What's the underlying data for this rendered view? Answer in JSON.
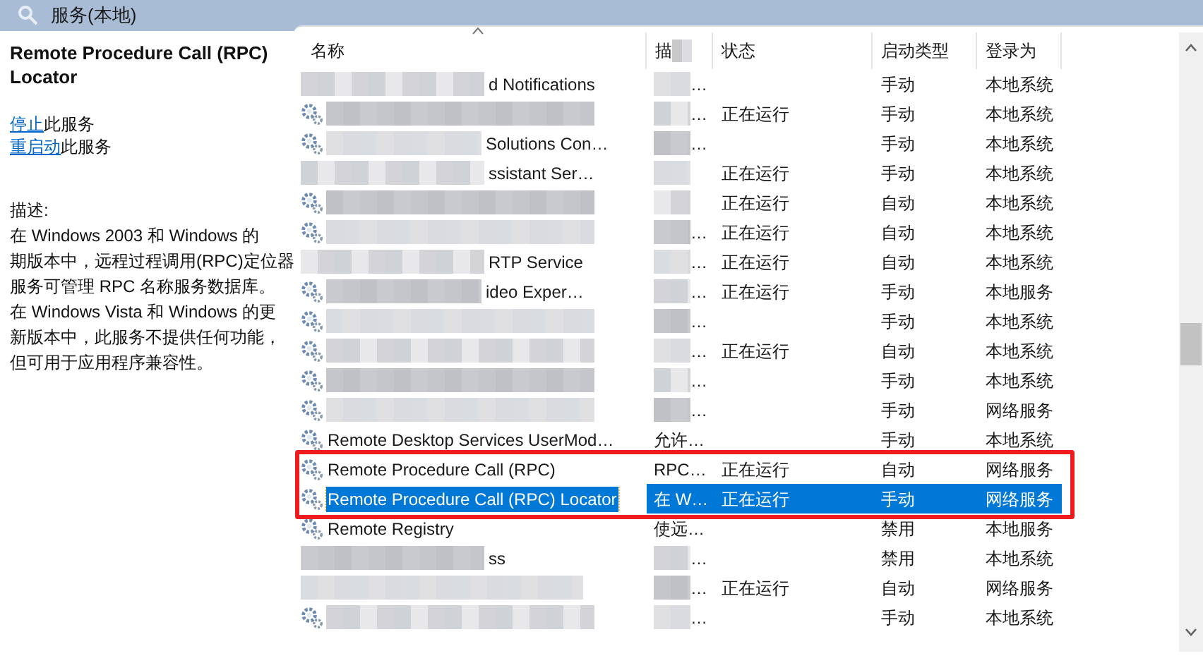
{
  "window": {
    "title": "服务(本地)"
  },
  "details": {
    "title": "Remote Procedure Call (RPC) Locator",
    "actions": [
      {
        "link": "停止",
        "text": "此服务"
      },
      {
        "link": "重启动",
        "text": "此服务"
      }
    ],
    "description_label": "描述:",
    "description_lines": [
      "在 Windows 2003 和 Windows 的",
      "期版本中，远程过程调用(RPC)定位器",
      "服务可管理 RPC 名称服务数据库。",
      "在 Windows Vista 和 Windows 的更",
      "新版本中，此服务不提供任何功能，",
      "但可用于应用程序兼容性。"
    ]
  },
  "table": {
    "columns": [
      "名称",
      "描",
      "状态",
      "启动类型",
      "登录为"
    ],
    "rows": [
      {
        "name": "d Notifications",
        "kind": "masked",
        "desc": "…",
        "desc_redacted": true,
        "status": "",
        "startup": "手动",
        "logon": "本地系统",
        "selected": false
      },
      {
        "kind": "blurred",
        "desc": "…",
        "desc_redacted": true,
        "status": "正在运行",
        "startup": "手动",
        "logon": "本地系统",
        "selected": false
      },
      {
        "name": "Solutions Con…",
        "kind": "blurred",
        "desc": "…",
        "desc_redacted": true,
        "status": "",
        "startup": "手动",
        "logon": "本地系统",
        "selected": false
      },
      {
        "name": "ssistant Ser…",
        "kind": "masked",
        "desc_redacted": true,
        "status": "正在运行",
        "startup": "手动",
        "logon": "本地系统",
        "selected": false
      },
      {
        "kind": "blurred",
        "desc_redacted": true,
        "status": "正在运行",
        "startup": "自动",
        "logon": "本地系统",
        "selected": false
      },
      {
        "kind": "blurred",
        "desc": "…",
        "desc_redacted": true,
        "status": "正在运行",
        "startup": "自动",
        "logon": "本地系统",
        "selected": false
      },
      {
        "name": "RTP Service",
        "kind": "masked",
        "desc": "…",
        "desc_redacted": true,
        "status": "正在运行",
        "startup": "自动",
        "logon": "本地系统",
        "selected": false
      },
      {
        "name": "ideo Exper…",
        "kind": "blurred",
        "desc": "…",
        "desc_redacted": true,
        "status": "正在运行",
        "startup": "手动",
        "logon": "本地服务",
        "selected": false
      },
      {
        "kind": "blurred",
        "desc": "…",
        "desc_redacted": true,
        "status": "",
        "startup": "手动",
        "logon": "本地系统",
        "selected": false
      },
      {
        "kind": "blurred",
        "desc": "…",
        "desc_redacted": true,
        "status": "正在运行",
        "startup": "自动",
        "logon": "本地系统",
        "selected": false
      },
      {
        "kind": "blurred",
        "desc": "…",
        "desc_redacted": true,
        "status": "",
        "startup": "手动",
        "logon": "本地系统",
        "selected": false
      },
      {
        "kind": "blurred",
        "desc": "…",
        "desc_redacted": true,
        "status": "",
        "startup": "手动",
        "logon": "网络服务",
        "selected": false
      },
      {
        "name": "Remote Desktop Services UserMod…",
        "kind": "plain",
        "desc": "允许…",
        "desc_redacted": false,
        "status": "",
        "startup": "手动",
        "logon": "本地系统",
        "selected": false
      },
      {
        "name": "Remote Procedure Call (RPC)",
        "kind": "plain",
        "desc": "RPC…",
        "desc_redacted": false,
        "status": "正在运行",
        "startup": "自动",
        "logon": "网络服务",
        "selected": false
      },
      {
        "name": "Remote Procedure Call (RPC) Locator",
        "kind": "plain",
        "desc": "在 W…",
        "desc_redacted": false,
        "status": "正在运行",
        "startup": "手动",
        "logon": "网络服务",
        "selected": true
      },
      {
        "name": "Remote Registry",
        "kind": "plain",
        "desc": "使远…",
        "desc_redacted": false,
        "status": "",
        "startup": "禁用",
        "logon": "本地服务",
        "selected": false
      },
      {
        "name": "ss",
        "kind": "masked",
        "desc": "…",
        "desc_redacted": true,
        "status": "",
        "startup": "禁用",
        "logon": "本地系统",
        "selected": false
      },
      {
        "kind": "masked",
        "desc": "…",
        "desc_redacted": true,
        "status": "正在运行",
        "startup": "自动",
        "logon": "网络服务",
        "selected": false
      },
      {
        "kind": "blurred",
        "desc": "…",
        "desc_redacted": true,
        "status": "",
        "startup": "手动",
        "logon": "本地系统",
        "selected": false
      }
    ]
  }
}
